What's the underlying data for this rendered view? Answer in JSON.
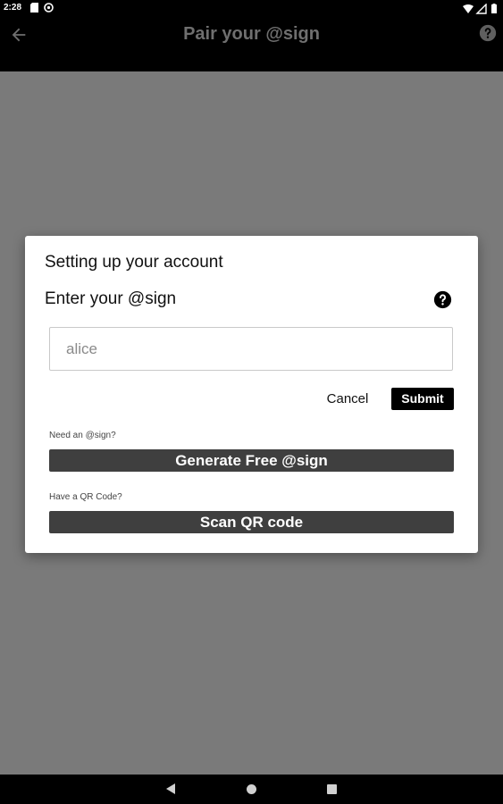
{
  "status_bar": {
    "time": "2:28",
    "icons_left": [
      "sd-card-icon",
      "at-sync-icon"
    ],
    "icons_right": [
      "wifi-icon",
      "cellular-icon",
      "battery-icon"
    ]
  },
  "app_bar": {
    "title": "Pair your @sign",
    "back_icon": "arrow-back-icon",
    "help_icon": "help-circle-icon"
  },
  "dialog": {
    "title": "Setting up your account",
    "field_label": "Enter your @sign",
    "input": {
      "value": "",
      "placeholder": "alice"
    },
    "cancel_label": "Cancel",
    "submit_label": "Submit",
    "need_hint": "Need an @sign?",
    "generate_label": "Generate Free @sign",
    "qr_hint": "Have a QR Code?",
    "scan_label": "Scan QR code"
  },
  "nav_bar": {
    "icons": [
      "nav-back-icon",
      "nav-home-icon",
      "nav-recents-icon"
    ]
  },
  "colors": {
    "scrim": "#7a7a7a",
    "app_bar": "#000000",
    "title_text": "#6f6f6f",
    "button_dark": "#3f3f3f",
    "submit_bg": "#000000"
  }
}
